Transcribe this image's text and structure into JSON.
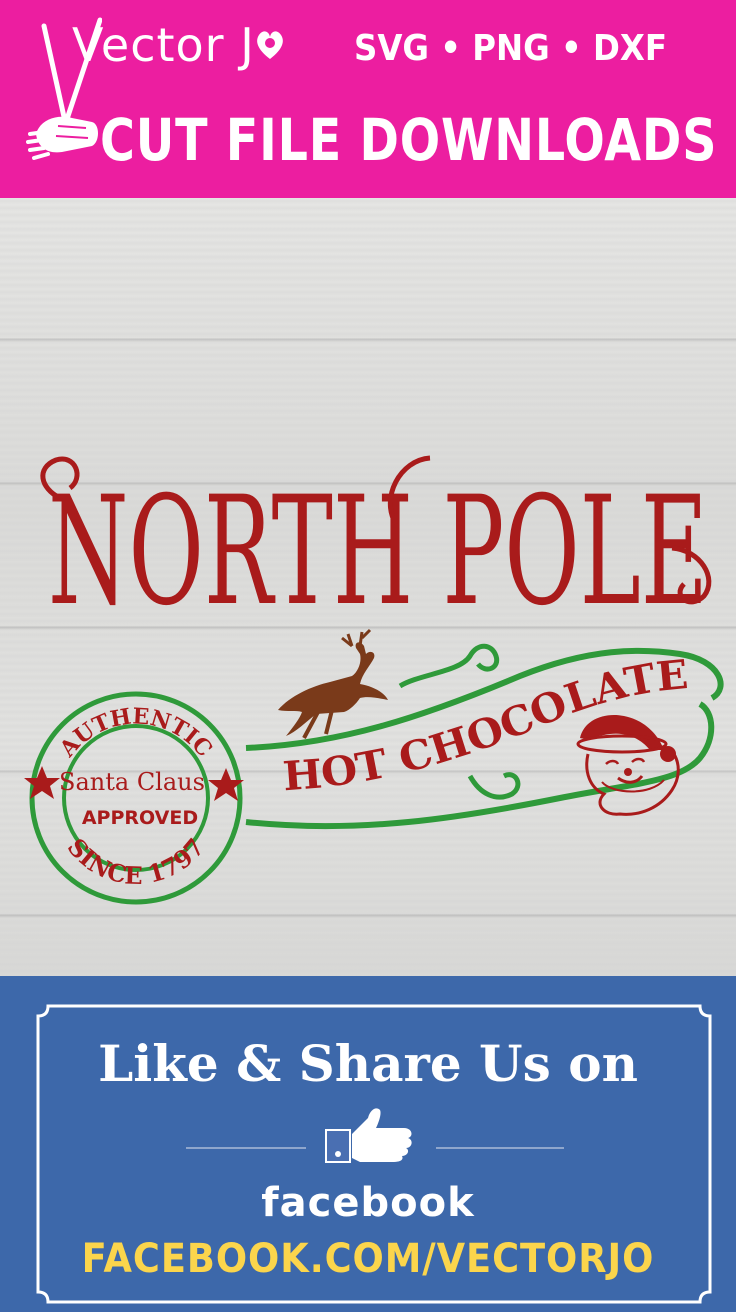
{
  "header": {
    "brand_prefix": "Vector J",
    "formats": "SVG • PNG • DXF",
    "tagline": "CUT FILE DOWNLOADS",
    "background": "#ec1ea0"
  },
  "design": {
    "title": "NORTH POLE",
    "subtitle": "HOT CHOCOLATE",
    "badge": {
      "top_text": "AUTHENTIC",
      "center_text": "Santa Claus",
      "approved_text": "APPROVED",
      "bottom_text": "SINCE 1797"
    },
    "colors": {
      "red": "#a91b1b",
      "green": "#2f9a3a",
      "brown": "#7a3a1a"
    },
    "icons": [
      "reindeer-icon",
      "santa-face-icon",
      "star-icon"
    ]
  },
  "footer": {
    "share_title": "Like & Share Us on",
    "network": "facebook",
    "url": "FACEBOOK.COM/VECTORJO",
    "background": "#3d68aa",
    "url_color": "#fbd54c"
  }
}
